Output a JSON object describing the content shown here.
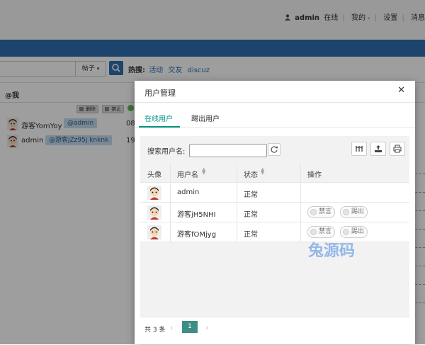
{
  "topbar": {
    "username": "admin",
    "status": "在线",
    "my": "我的",
    "settings": "设置",
    "messages": "消息"
  },
  "search": {
    "type_label": "帖子",
    "hot_label": "热搜:",
    "hot_items": [
      "活动",
      "交友",
      "discuz"
    ]
  },
  "panel": {
    "title": "@我",
    "mini_buttons": [
      "删除",
      "禁止"
    ],
    "rows": [
      {
        "name": "游客YomYoy",
        "mention": "@admin",
        "time": "08"
      },
      {
        "name": "admin",
        "mention": "@游客jZz95j knknk",
        "time": "19"
      }
    ]
  },
  "modal": {
    "title": "用户管理",
    "close": "✕",
    "tabs": [
      "在线用户",
      "踢出用户"
    ],
    "active_tab": 0,
    "search_label": "搜索用户名:",
    "search_value": "",
    "columns": [
      "头像",
      "用户名",
      "状态",
      "操作"
    ],
    "rows": [
      {
        "username": "admin",
        "status": "正常",
        "actions": []
      },
      {
        "username": "游客jH5NHI",
        "status": "正常",
        "actions": [
          "禁言",
          "踢出"
        ]
      },
      {
        "username": "游客fOMjyg",
        "status": "正常",
        "actions": [
          "禁言",
          "踢出"
        ]
      }
    ],
    "total": "共 3 条",
    "current_page": "1",
    "prev_icon": "‹",
    "next_icon": "›"
  },
  "icons": [
    "user-icon",
    "search-icon",
    "refresh-icon",
    "column-filter-icon",
    "export-icon",
    "print-icon",
    "sort-icon",
    "close-icon",
    "avatar-icon"
  ],
  "colors": {
    "nav_blue": "#2e6eaf",
    "accent_teal": "#009688",
    "page_active": "#3d8f85",
    "overlay": "rgba(0,0,0,0.38)"
  },
  "watermark": "兔源码"
}
